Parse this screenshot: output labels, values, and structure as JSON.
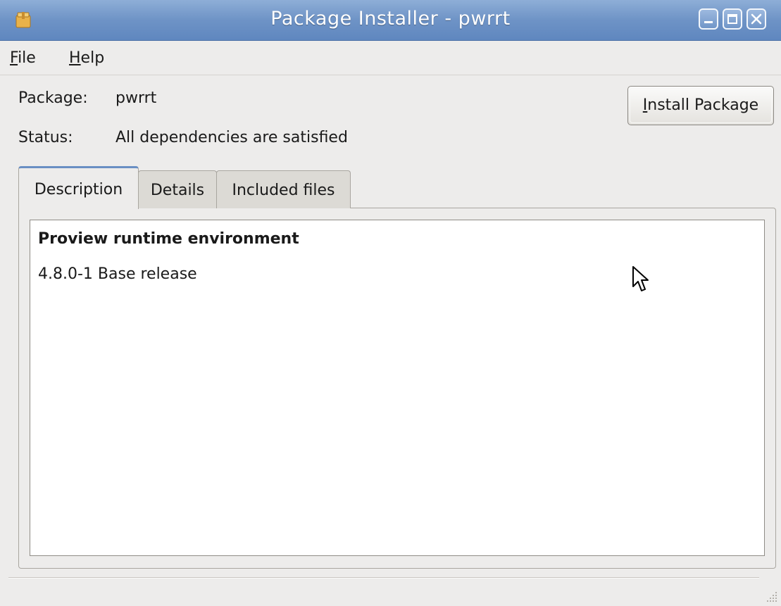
{
  "window": {
    "title": "Package Installer - pwrrt"
  },
  "menu": {
    "file_accel": "F",
    "file_rest": "ile",
    "help_accel": "H",
    "help_rest": "elp"
  },
  "info": {
    "package_label": "Package:",
    "package_value": "pwrrt",
    "status_label": "Status:",
    "status_value": "All dependencies are satisfied"
  },
  "install_button": {
    "accel": "I",
    "rest": "nstall Package"
  },
  "tabs": [
    {
      "label": "Description",
      "active": true
    },
    {
      "label": "Details",
      "active": false
    },
    {
      "label": "Included files",
      "active": false
    }
  ],
  "description": {
    "title": "Proview runtime environment",
    "version": "4.8.0-1 Base release"
  },
  "colors": {
    "titlebar": "#6e93c6",
    "accent_tab": "#6a8fc3"
  },
  "icons": [
    "package-icon",
    "minimize-icon",
    "maximize-icon",
    "close-icon",
    "mouse-cursor-icon",
    "resize-grip-icon"
  ]
}
